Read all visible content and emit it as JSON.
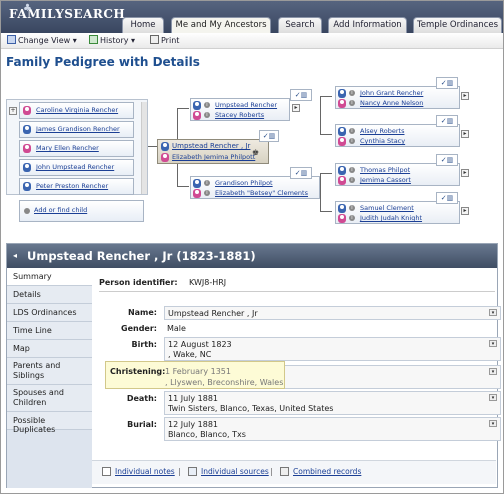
{
  "header": {
    "logo": "FAMILYSEARCH",
    "tabs": [
      "Home",
      "Me and My Ancestors",
      "Search",
      "Add Information",
      "Temple Ordinances"
    ],
    "active_tab": "Me and My Ancestors"
  },
  "toolbar": {
    "change_view": "Change View",
    "history": "History",
    "print": "Print"
  },
  "page_title": "Family Pedigree with Details",
  "children_list": [
    "Caroline Virginia Rencher",
    "James Grandison Rencher",
    "Mary Ellen Rencher",
    "John Umpstead Rencher",
    "Peter Preston Rencher"
  ],
  "add_child": "Add or find child",
  "focus": {
    "name": "Umpstead Rencher , Jr",
    "spouse": "Elizabeth Jemima Philpott"
  },
  "parents": [
    {
      "father": "Umpstead Rencher",
      "mother": "Stacey Roberts"
    },
    {
      "father": "Grandison Philpot",
      "mother": "Elizabeth \"Betsey\" Clements"
    }
  ],
  "grandparents": [
    {
      "father": "John Grant Rencher",
      "mother": "Nancy Anne Nelson"
    },
    {
      "father": "Alsey Roberts",
      "mother": "Cynthia Stacy"
    },
    {
      "father": "Thomas Philpot",
      "mother": "Jemima Cassort"
    },
    {
      "father": "Samuel Clement",
      "mother": "Judith Judah Knight"
    }
  ],
  "detail": {
    "heading": "Umpstead Rencher , Jr (1823-1881)",
    "side_menu": [
      "Summary",
      "Details",
      "LDS Ordinances",
      "Time Line",
      "Map",
      "Parents and Siblings",
      "Spouses and Children",
      "Possible Duplicates"
    ],
    "person_id_label": "Person identifier:",
    "person_id": "KWJ8-HRJ",
    "name_label": "Name:",
    "name_val": "Umpstead Rencher , Jr",
    "gender_label": "Gender:",
    "gender_val": "Male",
    "birth_label": "Birth:",
    "birth_date": "12 August 1823",
    "birth_place": ", Wake, NC",
    "christening_label": "Christening:",
    "christening_date": "1 February 1351",
    "christening_place": ", Llyswen, Breconshire, Wales",
    "death_label": "Death:",
    "death_date": "11 July 1881",
    "death_place": "Twin Sisters, Blanco, Texas, United States",
    "burial_label": "Burial:",
    "burial_date": "12 July 1881",
    "burial_place": "Blanco, Blanco, Txs",
    "footer": {
      "notes": "Individual notes",
      "sources": "Individual sources",
      "combined": "Combined records",
      "sep": "|"
    }
  }
}
